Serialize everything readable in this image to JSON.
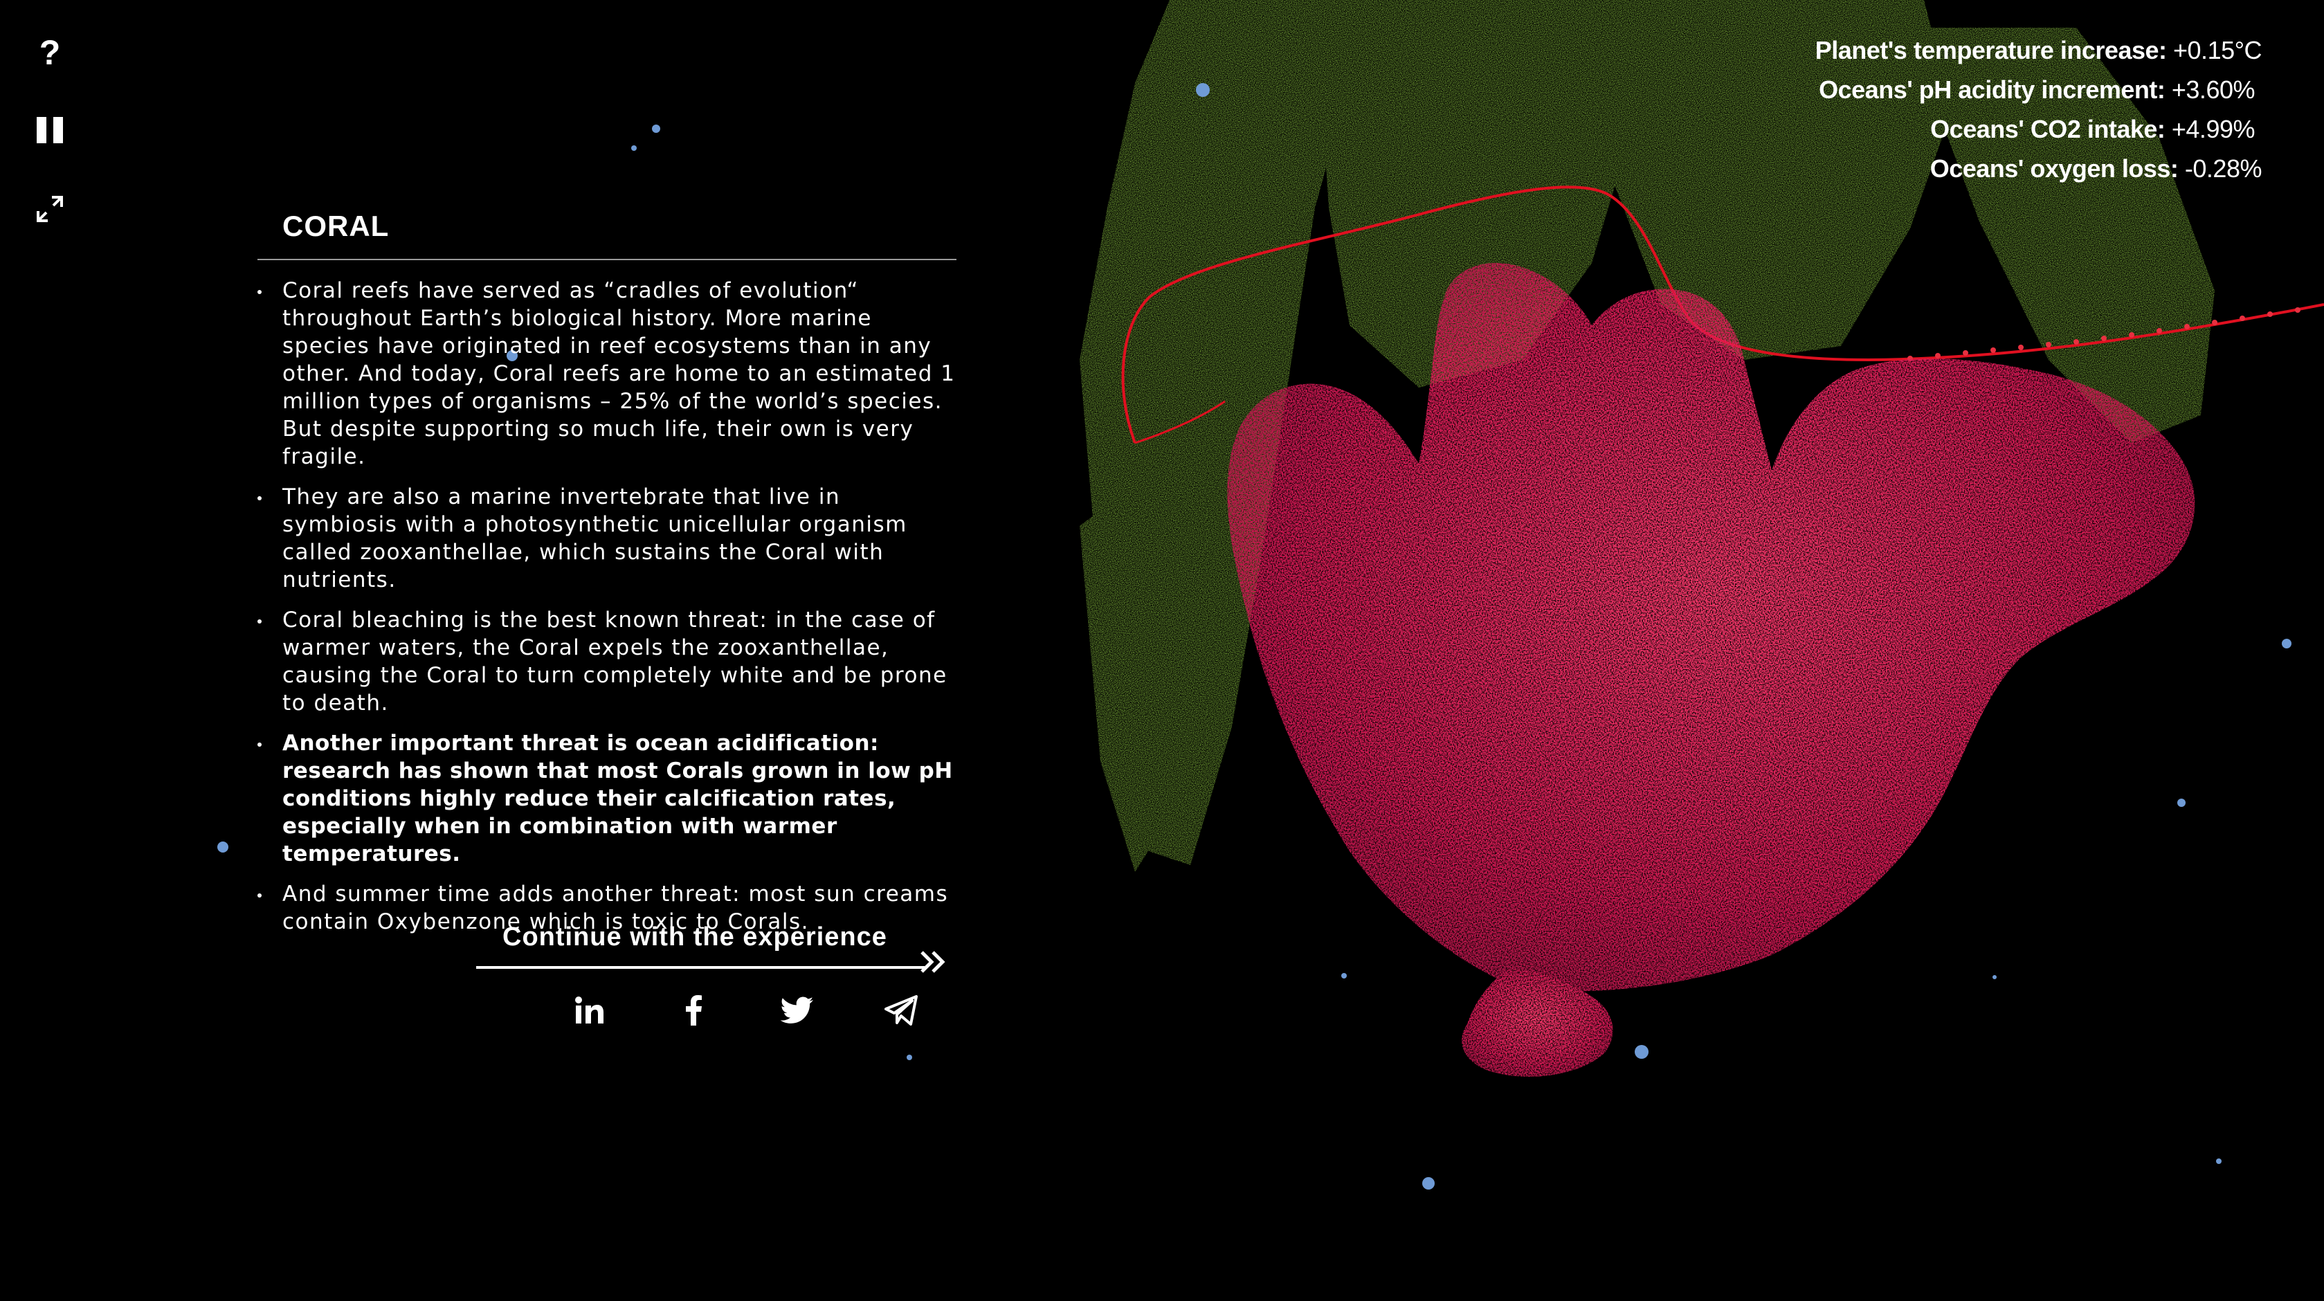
{
  "controls": {
    "help_label": "?"
  },
  "stats": [
    {
      "label": "Planet's temperature increase:",
      "value": "+0.15°C"
    },
    {
      "label": "Oceans' pH acidity increment:",
      "value": "+3.60%"
    },
    {
      "label": "Oceans' CO2 intake:",
      "value": "+4.99%"
    },
    {
      "label": "Oceans' oxygen loss:",
      "value": "-0.28%"
    }
  ],
  "panel": {
    "title": "CORAL",
    "bullets": [
      {
        "text": "Coral reefs have served as “cradles of evolution“ throughout Earth’s biological history. More marine species have originated in reef ecosystems than in any other. And today, Coral reefs are home to an estimated 1 million types of organisms – 25% of the world’s species. But despite supporting so much life, their own is very fragile."
      },
      {
        "text": "They are also a marine invertebrate that live in symbiosis with a photosynthetic unicellular organism called zooxanthellae, which sustains the Coral with nutrients."
      },
      {
        "text": "Coral bleaching is the best known threat: in the case of warmer waters, the Coral expels the zooxanthellae, causing the Coral to turn completely white and be prone to death."
      },
      {
        "text": "Another important threat is ocean acidification: research has shown that most Corals grown in low pH conditions highly reduce their calcification rates, especially when in combination with warmer temperatures."
      },
      {
        "text": "And summer time adds another threat: most sun creams contain Oxybenzone which is toxic to Corals."
      }
    ],
    "continue_label": "Continue with the experience"
  },
  "share": {
    "linkedin_icon": "linkedin-icon",
    "facebook_icon": "facebook-icon",
    "twitter_icon": "twitter-icon",
    "telegram_icon": "send-icon"
  },
  "colors": {
    "background": "#000000",
    "coral": "#e0205a",
    "seaweed": "#7fb13a",
    "path_line": "#e01020",
    "bubble": "#6f9bd6",
    "text": "#ffffff"
  }
}
